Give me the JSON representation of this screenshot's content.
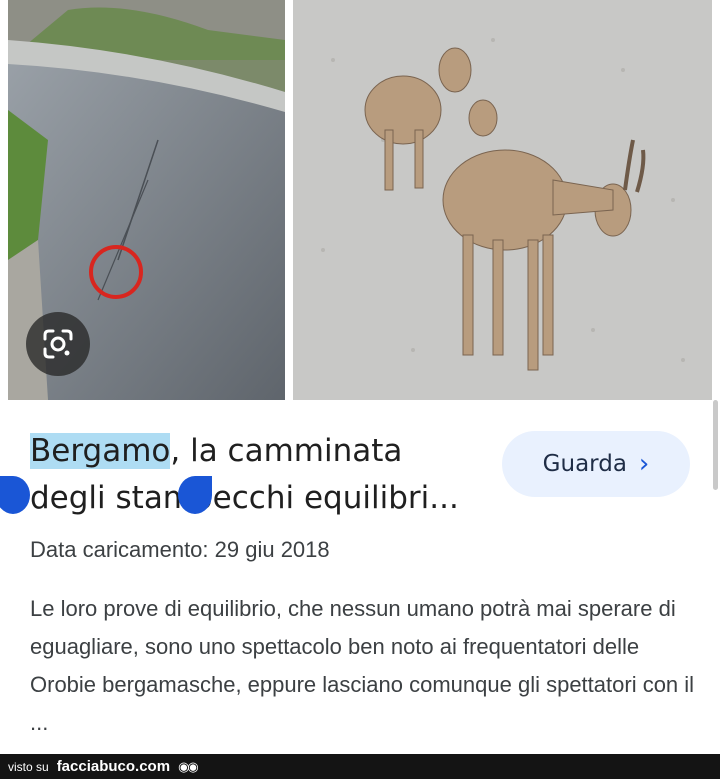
{
  "images": {
    "left": {
      "icon": "dam-with-circle-image"
    },
    "right": {
      "icon": "ibex-on-dam-wall-image"
    },
    "lens": {
      "icon": "google-lens-icon"
    }
  },
  "result": {
    "title_highlight": "Bergamo",
    "title_line1_rest": ", la camminata",
    "title_line2": "degli stambecchi equilibri...",
    "upload_label": "Data caricamento: 29 giu 2018",
    "description": "Le loro prove di equilibrio, che nessun umano potrà mai sperare di eguagliare, sono uno spettacolo ben noto ai frequentatori delle Orobie bergamasche, eppure lasciano comunque gli spettatori con il ..."
  },
  "button": {
    "label": "Guarda",
    "icon": "chevron-right-icon"
  },
  "footer": {
    "visto": "visto su",
    "brand": "facciabuco.com",
    "icon": "eyes-icon"
  },
  "colors": {
    "highlight": "#aedcf3",
    "handle": "#1a56d6",
    "button_bg": "#e9f1fe"
  }
}
